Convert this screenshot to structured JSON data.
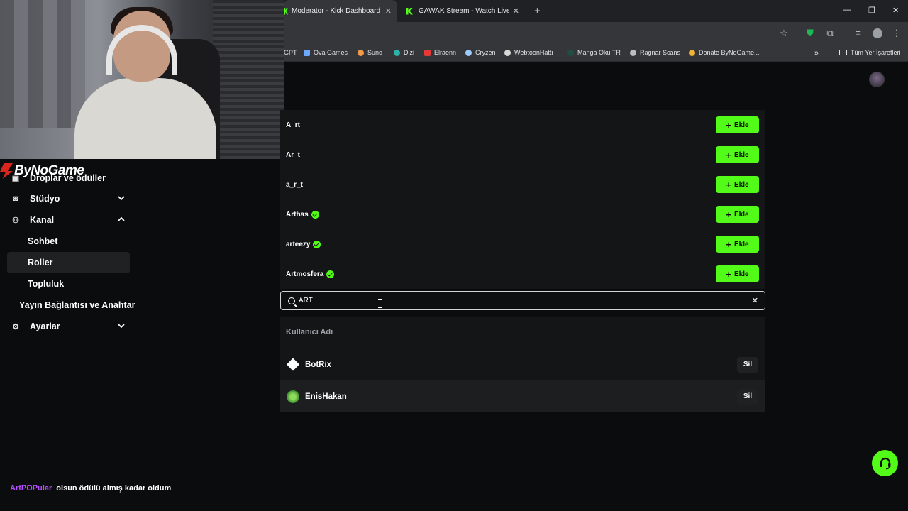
{
  "browser": {
    "tabs": [
      {
        "title": "Moderator - Kick Dashboard",
        "active": true
      },
      {
        "title": "GAWAK Stream - Watch Live on",
        "active": false
      }
    ],
    "bookmarks": [
      "GPT",
      "Ova Games",
      "Suno",
      "Dizi",
      "Elraenn",
      "Cryzen",
      "WebtoonHattı",
      "Manga Oku TR",
      "Ragnar Scans",
      "Donate ByNoGame...",
      "Tüm Yer İşaretleri"
    ]
  },
  "overlay": {
    "logo_text": "ByNoGame",
    "chat_user": "ArtPOPular",
    "chat_message": "olsun ödülü almış kadar oldum"
  },
  "sidebar": {
    "hidden_item": "Droplar ve ödüller",
    "items": [
      {
        "label": "Stüdyo",
        "icon": "studio-icon",
        "expandable": true
      },
      {
        "label": "Kanal",
        "icon": "channel-icon",
        "expanded": true
      },
      {
        "label": "Sohbet"
      },
      {
        "label": "Roller",
        "selected": true
      },
      {
        "label": "Topluluk"
      },
      {
        "label": "Yayın Bağlantısı ve Anahtar"
      },
      {
        "label": "Ayarlar",
        "icon": "gear-icon",
        "expandable": true
      }
    ]
  },
  "results": {
    "add_label": "Ekle",
    "users": [
      {
        "name": "A_rt",
        "verified": false
      },
      {
        "name": "Ar_t",
        "verified": false
      },
      {
        "name": "a_r_t",
        "verified": false
      },
      {
        "name": "Arthas",
        "verified": true
      },
      {
        "name": "arteezy",
        "verified": true
      },
      {
        "name": "Artmosfera",
        "verified": true
      }
    ]
  },
  "search": {
    "value": "ART"
  },
  "table": {
    "header": "Kullanıcı Adı",
    "remove_label": "Sil",
    "rows": [
      {
        "name": "BotRix"
      },
      {
        "name": "EnisHakan"
      }
    ]
  },
  "colors": {
    "accent": "#53fc18",
    "background": "#0b0c0d",
    "panel": "#141517"
  }
}
